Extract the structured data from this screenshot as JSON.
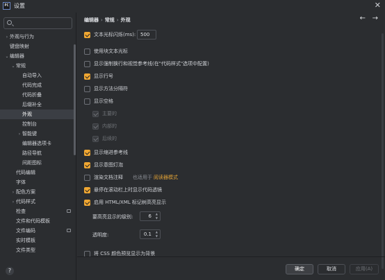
{
  "window": {
    "title": "设置",
    "icon": "pycharm-app-icon",
    "close": "✕"
  },
  "search": {
    "value": "",
    "placeholder": ""
  },
  "tree": [
    {
      "label": "外观与行为",
      "arrow": "›",
      "indent": 0
    },
    {
      "label": "键盘映射",
      "arrow": "",
      "indent": 0
    },
    {
      "label": "编辑器",
      "arrow": "⌄",
      "indent": 0
    },
    {
      "label": "常规",
      "arrow": "⌄",
      "indent": 1
    },
    {
      "label": "自动导入",
      "arrow": "",
      "indent": 2
    },
    {
      "label": "代码完成",
      "arrow": "",
      "indent": 2
    },
    {
      "label": "代码折叠",
      "arrow": "",
      "indent": 2
    },
    {
      "label": "后缀补全",
      "arrow": "",
      "indent": 2
    },
    {
      "label": "外观",
      "arrow": "",
      "indent": 2,
      "selected": true
    },
    {
      "label": "控制台",
      "arrow": "",
      "indent": 2
    },
    {
      "label": "智能键",
      "arrow": "›",
      "indent": 2
    },
    {
      "label": "编辑器选项卡",
      "arrow": "",
      "indent": 2
    },
    {
      "label": "路径导航",
      "arrow": "",
      "indent": 2
    },
    {
      "label": "间距图标",
      "arrow": "",
      "indent": 2
    },
    {
      "label": "代码编辑",
      "arrow": "",
      "indent": 1
    },
    {
      "label": "字体",
      "arrow": "",
      "indent": 1
    },
    {
      "label": "配色方案",
      "arrow": "›",
      "indent": 1
    },
    {
      "label": "代码样式",
      "arrow": "›",
      "indent": 1
    },
    {
      "label": "检查",
      "arrow": "",
      "indent": 1,
      "badge": true
    },
    {
      "label": "文件和代码模板",
      "arrow": "",
      "indent": 1
    },
    {
      "label": "文件编码",
      "arrow": "",
      "indent": 1,
      "badge": true
    },
    {
      "label": "实时模板",
      "arrow": "",
      "indent": 1
    },
    {
      "label": "文件类型",
      "arrow": "",
      "indent": 1
    }
  ],
  "breadcrumb": [
    "编辑器",
    "常规",
    "外观"
  ],
  "nav": {
    "back": "←",
    "forward": "→"
  },
  "options": {
    "caret_blink": {
      "label": "文本光标闪烁(ms):",
      "checked": true,
      "value": "500"
    },
    "block_caret": {
      "label": "使用块文本光标",
      "checked": false
    },
    "hard_wraps": {
      "label": "显示强制换行和视觉参考线(在\"代码样式\"选项中配置)",
      "checked": false
    },
    "line_numbers": {
      "label": "显示行号",
      "checked": true
    },
    "method_separators": {
      "label": "显示方法分隔符",
      "checked": false
    },
    "whitespaces": {
      "label": "显示空格",
      "checked": false
    },
    "leading": {
      "label": "主要的",
      "checked": true,
      "disabled": true
    },
    "inner": {
      "label": "内部的",
      "checked": true,
      "disabled": true
    },
    "trailing": {
      "label": "后续的",
      "checked": true,
      "disabled": true
    },
    "indent_guides": {
      "label": "显示缩进参考线",
      "checked": true
    },
    "intention_bulb": {
      "label": "显示意图灯泡",
      "checked": true
    },
    "render_docs": {
      "label": "渲染文档注释",
      "checked": false,
      "hint": "也适用于",
      "link": "阅读器模式"
    },
    "scrollbar_marks": {
      "label": "悬停在滚动栏上时显示代码透镜",
      "checked": true
    },
    "html_xml_tags": {
      "label": "启用 HTML/XML 标记树高亮显示",
      "checked": true
    },
    "levels": {
      "label": "要高亮显示的级别:",
      "value": "6"
    },
    "opacity": {
      "label": "透明度:",
      "value": "0.1"
    },
    "css_color": {
      "label": "将 CSS 颜色预览显示为背景",
      "checked": false
    }
  },
  "buttons": {
    "ok": "确定",
    "cancel": "取消",
    "apply": "应用(A)"
  },
  "help": "?",
  "colors": {
    "accent": "#f0a732",
    "background": "#2b2d30",
    "selection": "#3b3e44"
  }
}
